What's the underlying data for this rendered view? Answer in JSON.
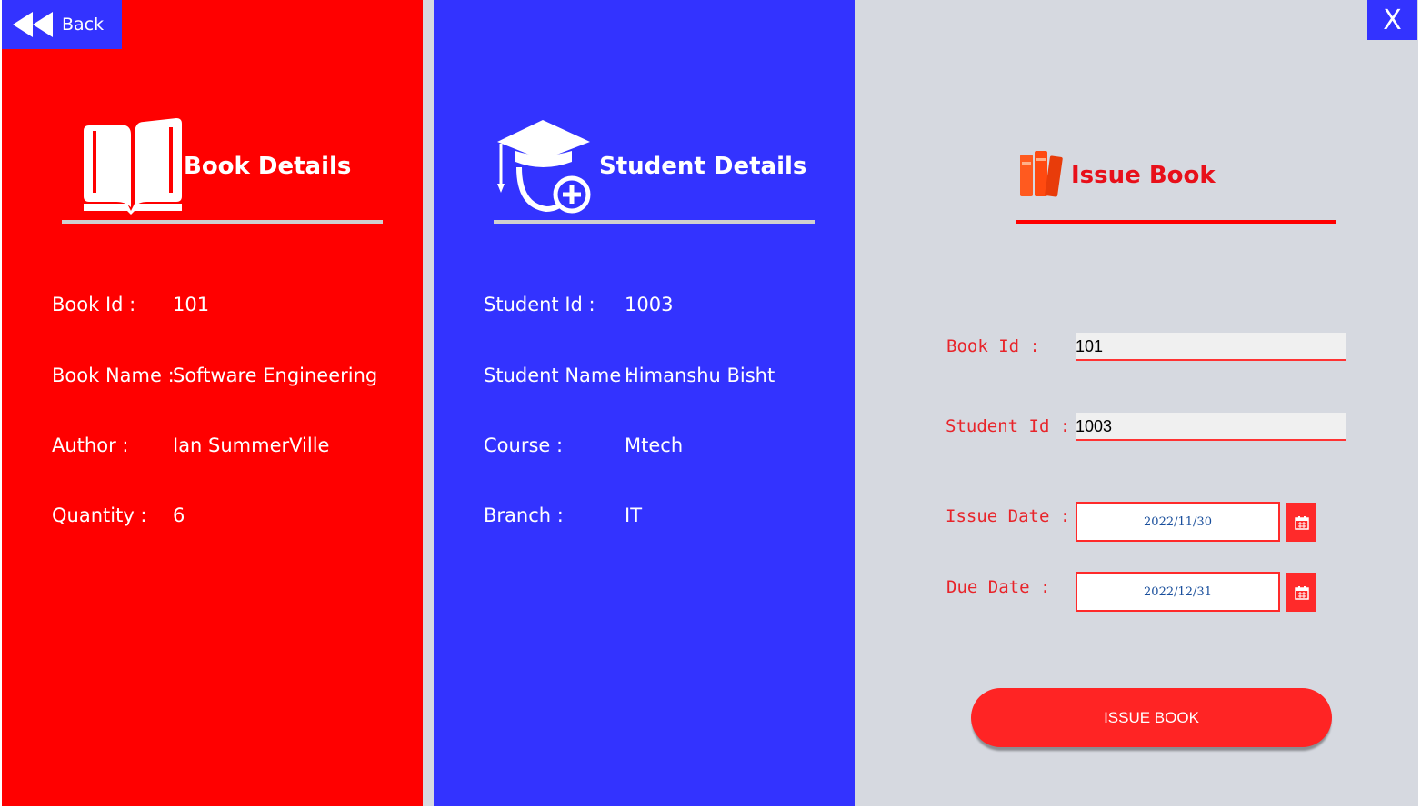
{
  "header": {
    "back_label": "Back",
    "close_label": "X"
  },
  "book_details": {
    "title": "Book Details",
    "fields": [
      {
        "label": "Book Id :",
        "value": "101"
      },
      {
        "label": "Book Name :",
        "value": "Software Engineering"
      },
      {
        "label": "Author :",
        "value": "Ian SummerVille"
      },
      {
        "label": "Quantity :",
        "value": "6"
      }
    ]
  },
  "student_details": {
    "title": "Student Details",
    "fields": [
      {
        "label": "Student Id :",
        "value": "1003"
      },
      {
        "label": "Student Name :",
        "value": "Himanshu Bisht"
      },
      {
        "label": "Course :",
        "value": "Mtech"
      },
      {
        "label": "Branch :",
        "value": "IT"
      }
    ]
  },
  "issue_form": {
    "title": "Issue Book",
    "book_id_label": "Book Id :",
    "book_id_value": "101",
    "student_id_label": "Student Id :",
    "student_id_value": "1003",
    "issue_date_label": "Issue Date :",
    "issue_date_value": "2022/11/30",
    "due_date_label": "Due Date :",
    "due_date_value": "2022/12/31",
    "submit_label": "ISSUE BOOK"
  },
  "icons": [
    "rewind-icon",
    "open-book-icon",
    "student-graduate-icon",
    "books-icon",
    "calendar-icon"
  ],
  "colors": {
    "book_panel": "#ff0000",
    "student_panel": "#3333ff",
    "issue_panel": "#d6d9e0",
    "accent": "#ff2424"
  }
}
